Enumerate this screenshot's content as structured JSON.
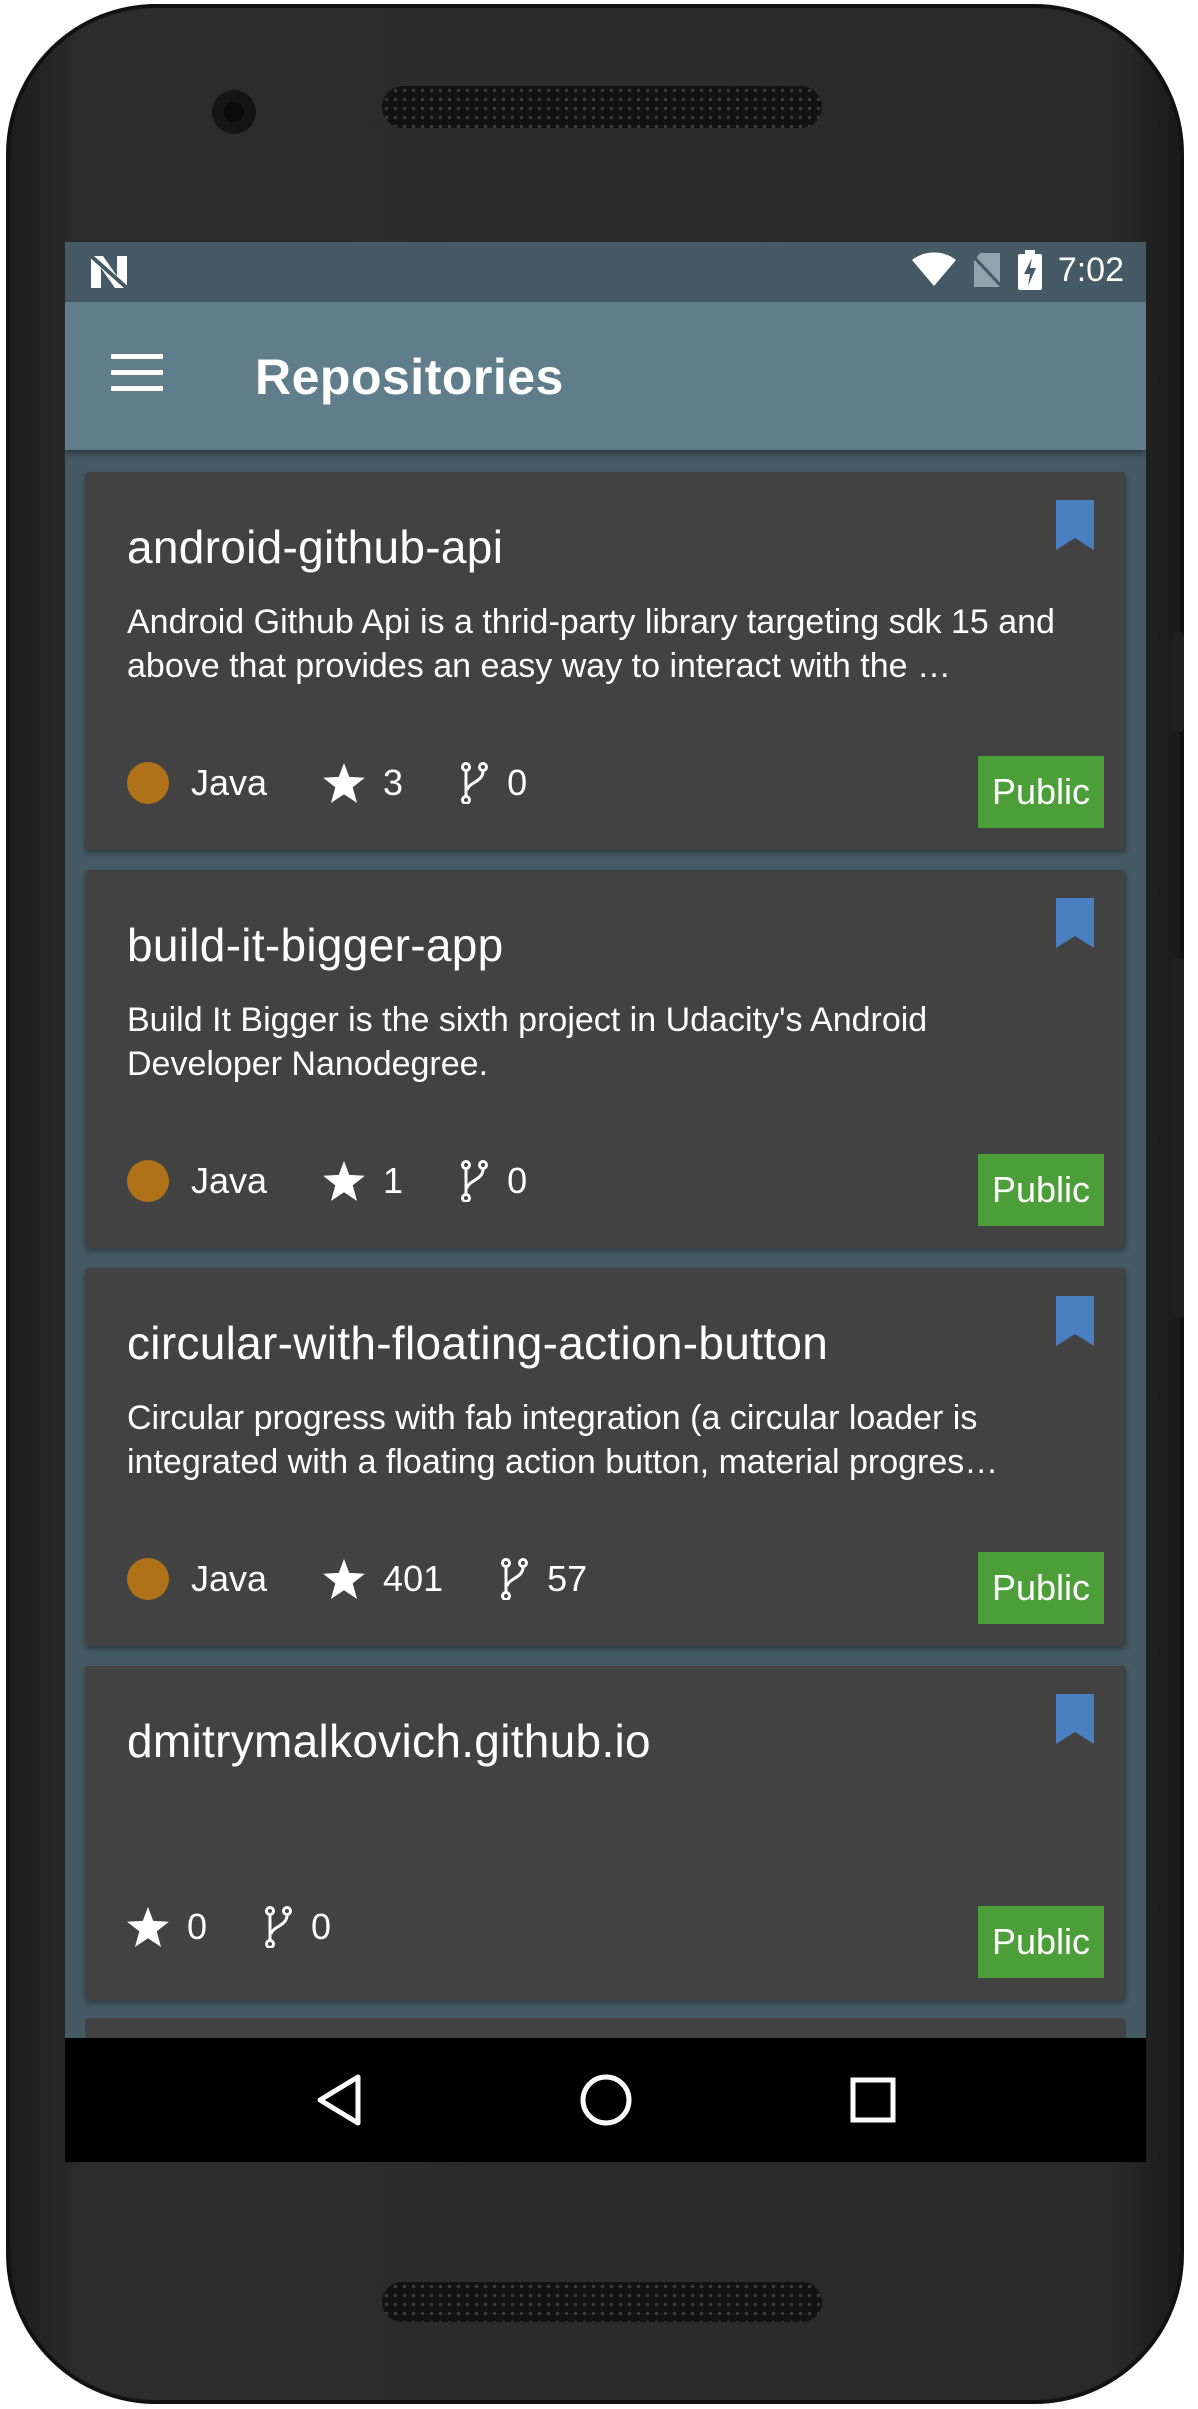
{
  "status_bar": {
    "time": "7:02",
    "icons": [
      "notification-n-icon",
      "wifi-icon",
      "no-sim-icon",
      "battery-charging-icon"
    ]
  },
  "app_bar": {
    "title": "Repositories",
    "menu_icon": "hamburger-menu-icon"
  },
  "repositories": [
    {
      "name": "android-github-api",
      "description": "Android Github Api is a thrid-party library targeting sdk 15 and above that provides an easy way to interact with the …",
      "language": "Java",
      "language_color": "#b07219",
      "stars": "3",
      "forks": "0",
      "visibility": "Public"
    },
    {
      "name": "build-it-bigger-app",
      "description": "Build It Bigger is the sixth project in Udacity's Android Developer Nanodegree.",
      "language": "Java",
      "language_color": "#b07219",
      "stars": "1",
      "forks": "0",
      "visibility": "Public"
    },
    {
      "name": "circular-with-floating-action-button",
      "description": "Circular progress with fab integration (a circular loader is integrated with a floating action button, material progres…",
      "language": "Java",
      "language_color": "#b07219",
      "stars": "401",
      "forks": "57",
      "visibility": "Public"
    },
    {
      "name": "dmitrymalkovich.github.io",
      "description": "",
      "language": "",
      "stars": "0",
      "forks": "0",
      "visibility": "Public"
    }
  ],
  "colors": {
    "status_bar": "#455a64",
    "app_bar": "#607d8b",
    "card": "#424242",
    "badge_public": "#4c9f38",
    "bookmark": "#4a7fc1"
  },
  "nav_bar": {
    "buttons": [
      "back-icon",
      "home-icon",
      "recents-icon"
    ]
  }
}
